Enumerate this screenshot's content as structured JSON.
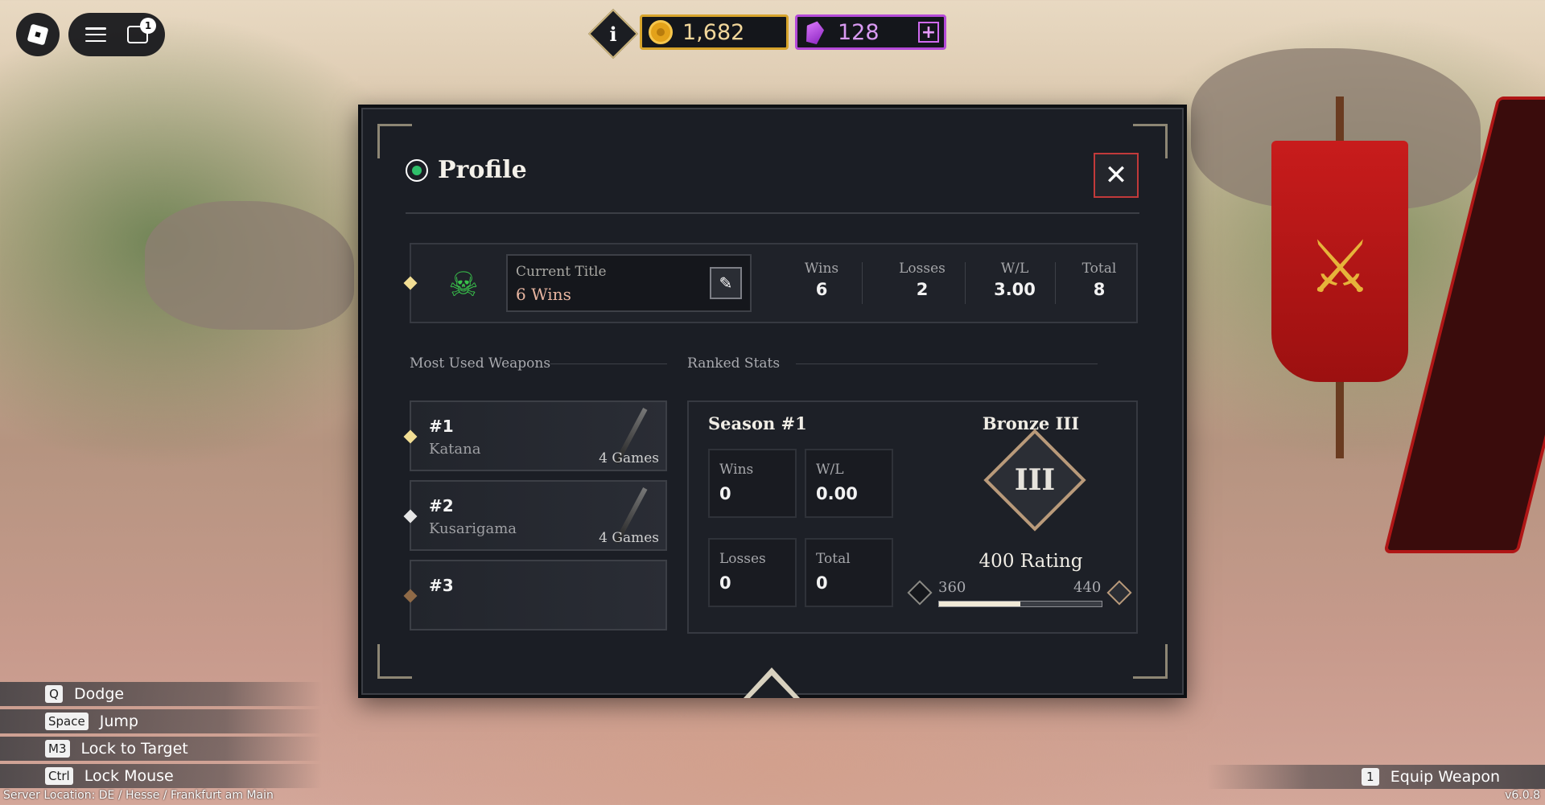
{
  "hud": {
    "info_label": "i",
    "coins": "1,682",
    "gems": "128",
    "gems_plus": "+",
    "chat_badge": "1"
  },
  "profile": {
    "title": "Profile",
    "close_label": "✕",
    "current_title_label": "Current Title",
    "current_title_value": "6 Wins",
    "stats": [
      {
        "label": "Wins",
        "value": "6"
      },
      {
        "label": "Losses",
        "value": "2"
      },
      {
        "label": "W/L",
        "value": "3.00"
      },
      {
        "label": "Total",
        "value": "8"
      }
    ],
    "most_used_label": "Most Used Weapons",
    "ranked_label": "Ranked Stats",
    "weapons": [
      {
        "rank": "#1",
        "name": "Katana",
        "games": "4 Games"
      },
      {
        "rank": "#2",
        "name": "Kusarigama",
        "games": "4 Games"
      },
      {
        "rank": "#3",
        "name": "",
        "games": ""
      }
    ],
    "ranked": {
      "season": "Season #1",
      "wins_label": "Wins",
      "wins": "0",
      "wl_label": "W/L",
      "wl": "0.00",
      "losses_label": "Losses",
      "losses": "0",
      "total_label": "Total",
      "total": "0",
      "tier": "Bronze III",
      "tier_numeral": "III",
      "rating": "400 Rating",
      "range_low": "360",
      "range_high": "440",
      "progress": 0.5
    }
  },
  "keybinds": [
    {
      "key": "Q",
      "label": "Dodge"
    },
    {
      "key": "Space",
      "label": "Jump"
    },
    {
      "key": "M3",
      "label": "Lock to Target"
    },
    {
      "key": "Ctrl",
      "label": "Lock Mouse"
    }
  ],
  "equip": {
    "key": "1",
    "label": "Equip Weapon"
  },
  "server_location": "Server Location: DE / Hesse / Frankfurt am Main",
  "version": "v6.0.8"
}
